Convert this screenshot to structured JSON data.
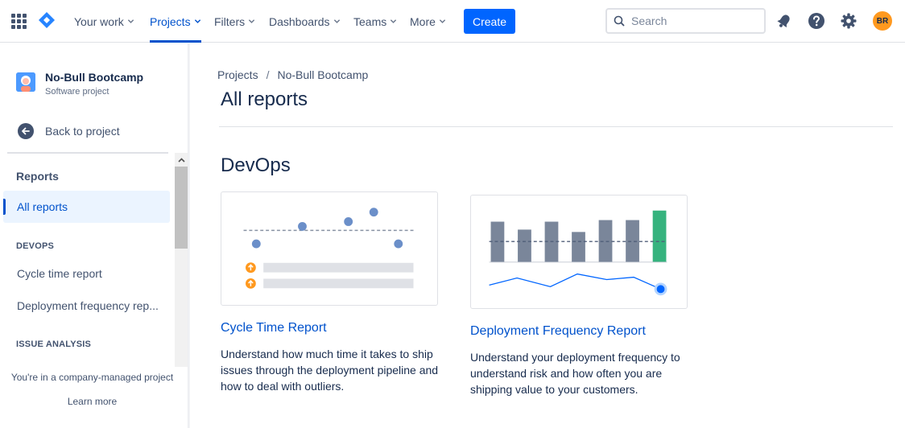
{
  "topnav": {
    "items": [
      {
        "label": "Your work",
        "active": false
      },
      {
        "label": "Projects",
        "active": true
      },
      {
        "label": "Filters",
        "active": false
      },
      {
        "label": "Dashboards",
        "active": false
      },
      {
        "label": "Teams",
        "active": false
      },
      {
        "label": "More",
        "active": false
      }
    ],
    "create_label": "Create",
    "search_placeholder": "Search",
    "avatar_initials": "BR",
    "accent": "#0052cc",
    "create_color": "#0065ff"
  },
  "sidebar": {
    "project_name": "No-Bull Bootcamp",
    "project_type": "Software project",
    "back_label": "Back to project",
    "reports_heading": "Reports",
    "items": [
      {
        "label": "All reports",
        "selected": true
      }
    ],
    "groups": [
      {
        "title": "DEVOPS",
        "items": [
          {
            "label": "Cycle time report"
          },
          {
            "label": "Deployment frequency rep..."
          }
        ]
      },
      {
        "title": "ISSUE ANALYSIS",
        "items": []
      }
    ],
    "footer_note": "You're in a company-managed project",
    "footer_link": "Learn more"
  },
  "main": {
    "breadcrumb": [
      "Projects",
      "No-Bull Bootcamp"
    ],
    "title": "All reports",
    "section_title": "DevOps",
    "cards": [
      {
        "title": "Cycle Time Report",
        "description": "Understand how much time it takes to ship issues through the deployment pipeline and how to deal with outliers."
      },
      {
        "title": "Deployment Frequency Report",
        "description": "Understand your deployment frequency to understand risk and how often you are shipping value to your customers."
      }
    ]
  },
  "colors": {
    "chart_bar": "#7a869a",
    "chart_bar_highlight": "#36b37e",
    "chart_point": "#6b8fc9",
    "warning_icon": "#ff991f"
  }
}
